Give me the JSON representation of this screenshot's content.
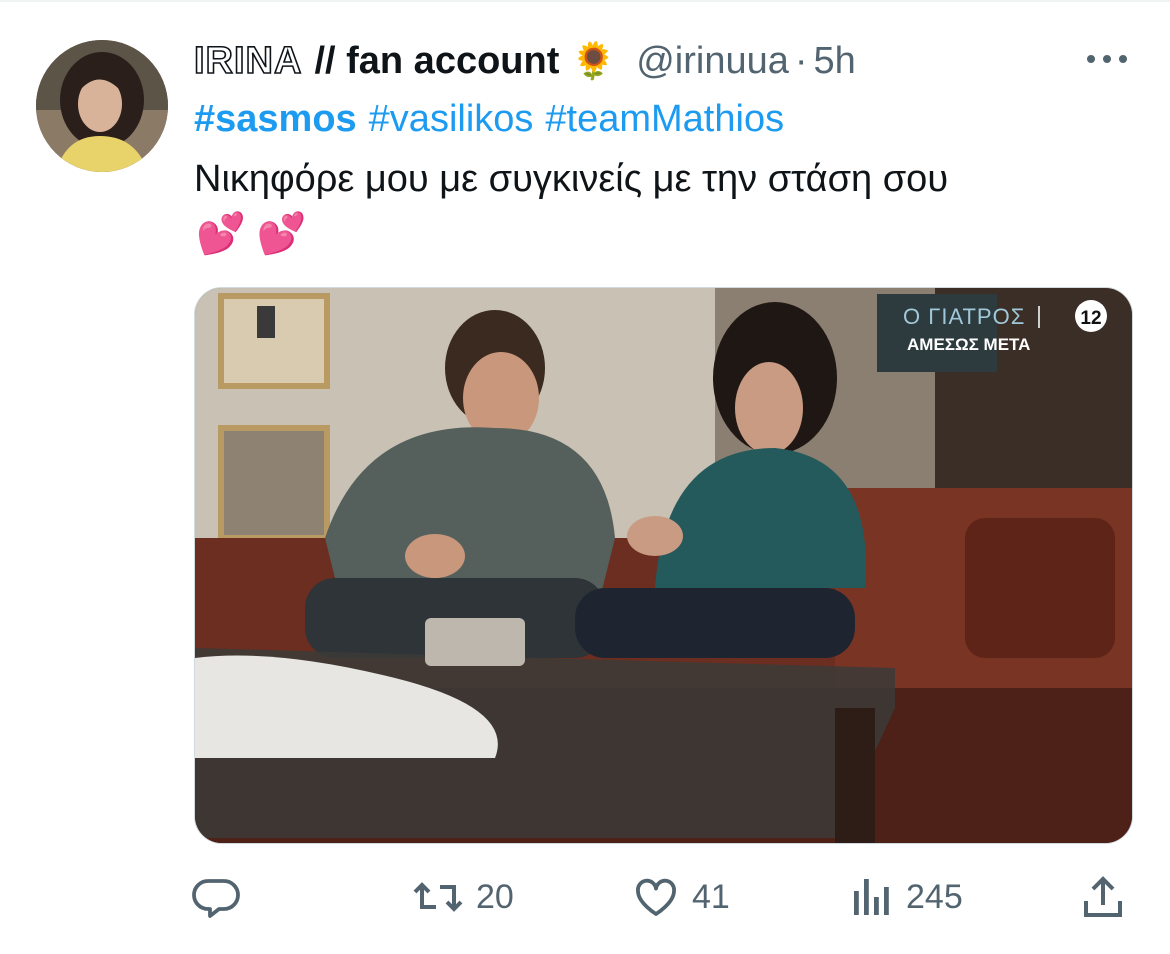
{
  "tweet": {
    "display_name_outline": "IRINA",
    "display_name_rest": "// fan account",
    "display_name_emoji": "🌻",
    "handle": "@irinuua",
    "separator": "·",
    "time": "5h",
    "hashtags": [
      "#sasmos",
      "#vasilikos",
      "#teamMathios"
    ],
    "text": "Νικηφόρε μου με συγκινείς με την στάση σου",
    "emojis": "💕 💕"
  },
  "media": {
    "overlay_title": "Ο ΓΙΑΤΡΟΣ",
    "overlay_subtitle": "ΑΜΕΣΩΣ ΜΕΤΑ",
    "channel_logo": "12"
  },
  "actions": {
    "reply_icon": "reply-icon",
    "retweet_icon": "retweet-icon",
    "retweet_count": "20",
    "like_icon": "heart-icon",
    "like_count": "41",
    "views_icon": "views-icon",
    "views_count": "245",
    "share_icon": "share-icon"
  },
  "colors": {
    "link": "#1d9bf0",
    "text": "#0f1419",
    "secondary": "#536471"
  }
}
